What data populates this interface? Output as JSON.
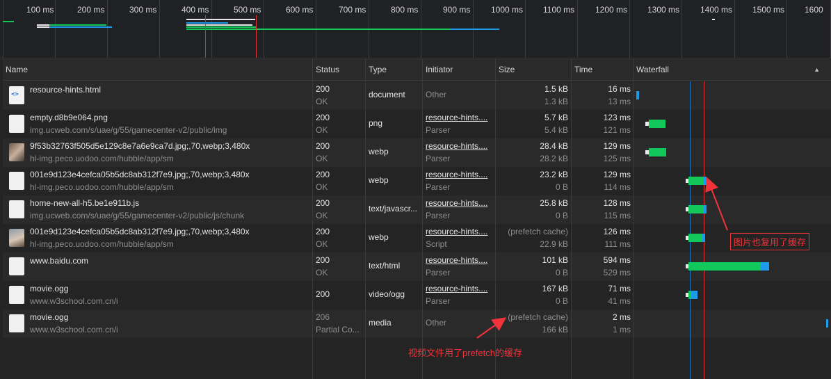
{
  "overview": {
    "ticks": [
      "100 ms",
      "200 ms",
      "300 ms",
      "400 ms",
      "500 ms",
      "600 ms",
      "700 ms",
      "800 ms",
      "900 ms",
      "1000 ms",
      "1100 ms",
      "1200 ms",
      "1300 ms",
      "1400 ms",
      "1500 ms",
      "1600"
    ]
  },
  "columns": {
    "name": "Name",
    "status": "Status",
    "type": "Type",
    "initiator": "Initiator",
    "size": "Size",
    "time": "Time",
    "waterfall": "Waterfall",
    "sort_indicator": "▲"
  },
  "requests": [
    {
      "name": "resource-hints.html",
      "domain": "",
      "status": "200",
      "status_text": "OK",
      "type": "document",
      "initiator": "Other",
      "initiator_sub": "",
      "size": "1.5 kB",
      "resource_size": "1.3 kB",
      "time": "16 ms",
      "latency": "13 ms"
    },
    {
      "name": "empty.d8b9e064.png",
      "domain": "img.ucweb.com/s/uae/g/55/gamecenter-v2/public/img",
      "status": "200",
      "status_text": "OK",
      "type": "png",
      "initiator": "resource-hints....",
      "initiator_sub": "Parser",
      "size": "5.7 kB",
      "resource_size": "5.4 kB",
      "time": "123 ms",
      "latency": "121 ms"
    },
    {
      "name": "9f53b32763f505d5e129c8e7a6e9ca7d.jpg;,70,webp;3,480x",
      "domain": "hl-img.peco.uodoo.com/hubble/app/sm",
      "status": "200",
      "status_text": "OK",
      "type": "webp",
      "initiator": "resource-hints....",
      "initiator_sub": "Parser",
      "size": "28.4 kB",
      "resource_size": "28.2 kB",
      "time": "129 ms",
      "latency": "125 ms"
    },
    {
      "name": "001e9d123e4cefca05b5dc8ab312f7e9.jpg;,70,webp;3,480x",
      "domain": "hl-img.peco.uodoo.com/hubble/app/sm",
      "status": "200",
      "status_text": "OK",
      "type": "webp",
      "initiator": "resource-hints....",
      "initiator_sub": "Parser",
      "size": "23.2 kB",
      "resource_size": "0 B",
      "time": "129 ms",
      "latency": "114 ms"
    },
    {
      "name": "home-new-all-h5.be1e911b.js",
      "domain": "img.ucweb.com/s/uae/g/55/gamecenter-v2/public/js/chunk",
      "status": "200",
      "status_text": "OK",
      "type": "text/javascr...",
      "initiator": "resource-hints....",
      "initiator_sub": "Parser",
      "size": "25.8 kB",
      "resource_size": "0 B",
      "time": "128 ms",
      "latency": "115 ms"
    },
    {
      "name": "001e9d123e4cefca05b5dc8ab312f7e9.jpg;,70,webp;3,480x",
      "domain": "hl-img.peco.uodoo.com/hubble/app/sm",
      "status": "200",
      "status_text": "OK",
      "type": "webp",
      "initiator": "resource-hints....",
      "initiator_sub": "Script",
      "size": "(prefetch cache)",
      "resource_size": "22.9 kB",
      "time": "126 ms",
      "latency": "111 ms"
    },
    {
      "name": "www.baidu.com",
      "domain": "",
      "status": "200",
      "status_text": "OK",
      "type": "text/html",
      "initiator": "resource-hints....",
      "initiator_sub": "Parser",
      "size": "101 kB",
      "resource_size": "0 B",
      "time": "594 ms",
      "latency": "529 ms"
    },
    {
      "name": "movie.ogg",
      "domain": "www.w3school.com.cn/i",
      "status": "200",
      "status_text": "",
      "type": "video/ogg",
      "initiator": "resource-hints....",
      "initiator_sub": "Parser",
      "size": "167 kB",
      "resource_size": "0 B",
      "time": "71 ms",
      "latency": "41 ms"
    },
    {
      "name": "movie.ogg",
      "domain": "www.w3school.com.cn/i",
      "status": "206",
      "status_text": "Partial Co...",
      "type": "media",
      "initiator": "Other",
      "initiator_sub": "",
      "size": "(prefetch cache)",
      "resource_size": "166 kB",
      "time": "2 ms",
      "latency": "1 ms"
    }
  ],
  "annotations": {
    "image_cache": "图片也复用了缓存",
    "video_cache": "视频文件用了prefetch的缓存"
  },
  "colors": {
    "waiting": "#13c85a",
    "download": "#1d9bea",
    "dom_content_loaded": "#1f73c4",
    "load": "#e53935",
    "annotation": "#f2333a"
  }
}
